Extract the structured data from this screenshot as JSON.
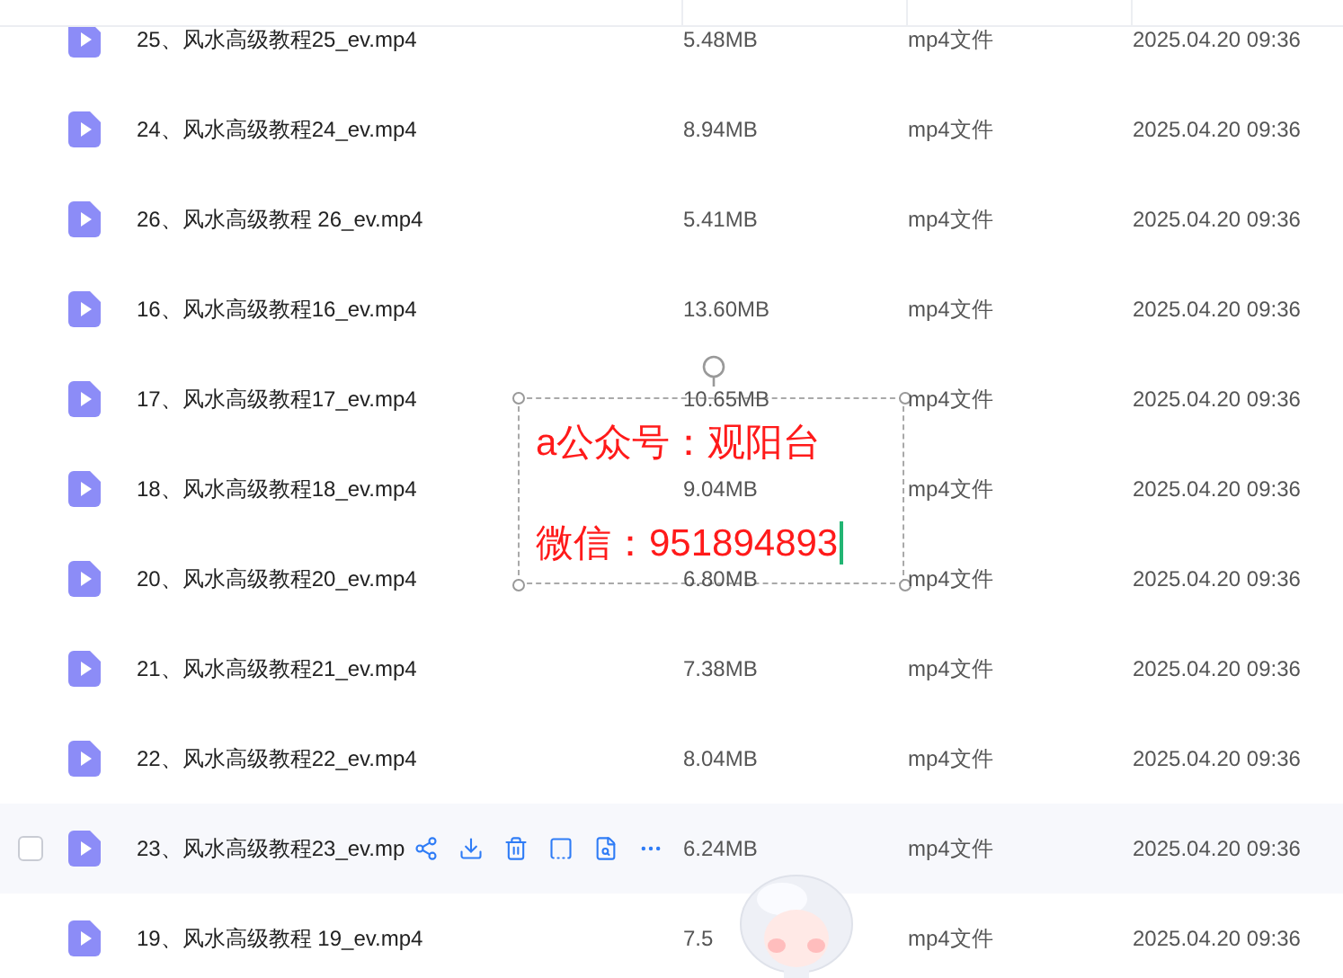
{
  "files": [
    {
      "name": "25、风水高级教程25_ev.mp4",
      "size": "5.48MB",
      "type": "mp4文件",
      "modified": "2025.04.20 09:36",
      "hovered": false
    },
    {
      "name": "24、风水高级教程24_ev.mp4",
      "size": "8.94MB",
      "type": "mp4文件",
      "modified": "2025.04.20 09:36",
      "hovered": false
    },
    {
      "name": "26、风水高级教程 26_ev.mp4",
      "size": "5.41MB",
      "type": "mp4文件",
      "modified": "2025.04.20 09:36",
      "hovered": false
    },
    {
      "name": "16、风水高级教程16_ev.mp4",
      "size": "13.60MB",
      "type": "mp4文件",
      "modified": "2025.04.20 09:36",
      "hovered": false
    },
    {
      "name": "17、风水高级教程17_ev.mp4",
      "size": "10.65MB",
      "type": "mp4文件",
      "modified": "2025.04.20 09:36",
      "hovered": false
    },
    {
      "name": "18、风水高级教程18_ev.mp4",
      "size": "9.04MB",
      "type": "mp4文件",
      "modified": "2025.04.20 09:36",
      "hovered": false
    },
    {
      "name": "20、风水高级教程20_ev.mp4",
      "size": "6.80MB",
      "type": "mp4文件",
      "modified": "2025.04.20 09:36",
      "hovered": false
    },
    {
      "name": "21、风水高级教程21_ev.mp4",
      "size": "7.38MB",
      "type": "mp4文件",
      "modified": "2025.04.20 09:36",
      "hovered": false
    },
    {
      "name": "22、风水高级教程22_ev.mp4",
      "size": "8.04MB",
      "type": "mp4文件",
      "modified": "2025.04.20 09:36",
      "hovered": false
    },
    {
      "name": "23、风水高级教程23_ev.mp",
      "size": "6.24MB",
      "type": "mp4文件",
      "modified": "2025.04.20 09:36",
      "hovered": true
    },
    {
      "name": "19、风水高级教程 19_ev.mp4",
      "size": "7.5",
      "type": "mp4文件",
      "modified": "2025.04.20 09:36",
      "hovered": false
    }
  ],
  "text_box": {
    "lines": [
      "a公众号：观阳台",
      "微信：951894893"
    ]
  }
}
